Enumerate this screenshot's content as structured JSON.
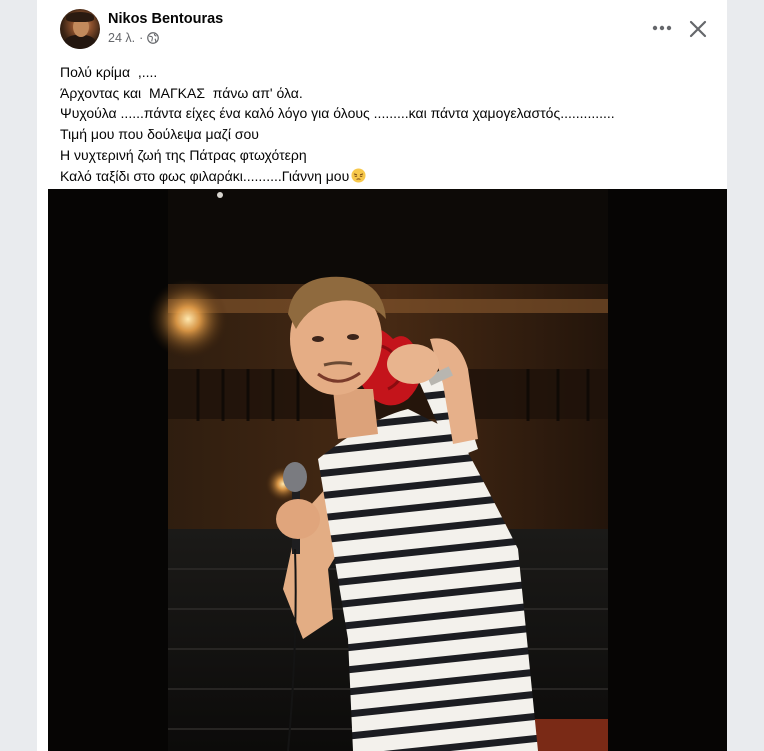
{
  "post": {
    "author": "Nikos Bentouras",
    "time": "24 λ.",
    "separator": "·",
    "privacy_icon": "globe-icon",
    "lines": [
      "Πολύ κρίμα  ,....",
      "Άρχοντας και  ΜΑΓΚΑΣ  πάνω απ' όλα.",
      "Ψυχούλα ......πάντα είχες ένα καλό λόγο για όλους .........και πάντα χαμογελαστός..............",
      "Τιμή μου που δούλεψα μαζί σου",
      "Η νυχτερινή ζωή της Πάτρας φτωχότερη",
      "Καλό ταξίδι στο φως φιλαράκι..........Γιάννη μου"
    ],
    "emoji": "pensive-face-emoji"
  },
  "header_actions": {
    "more_icon": "more-horizontal-icon",
    "close_icon": "close-icon"
  },
  "colors": {
    "author": "#050505",
    "meta": "#65676b",
    "background": "#e9ebee",
    "card": "#ffffff"
  }
}
